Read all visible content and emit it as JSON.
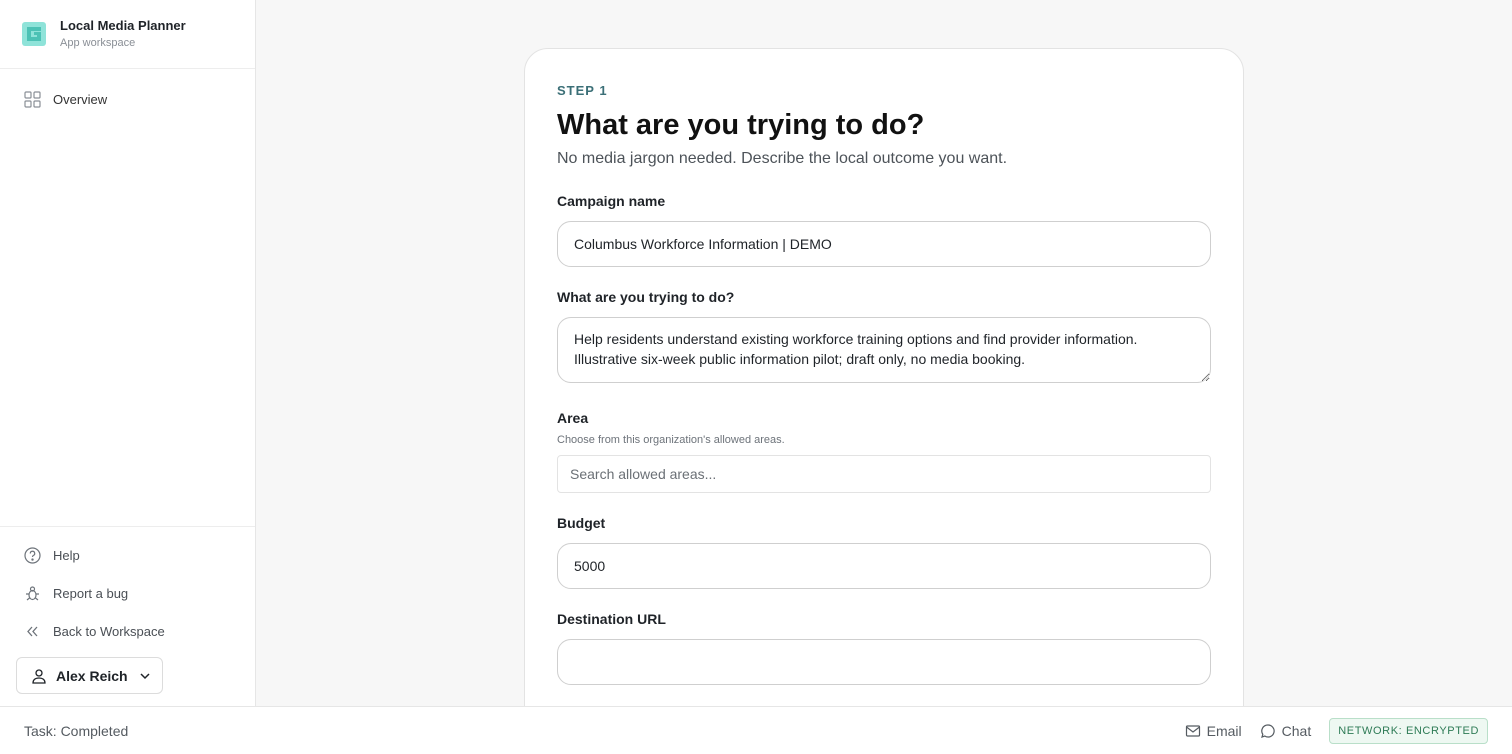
{
  "brand": {
    "title": "Local Media Planner",
    "subtitle": "App workspace"
  },
  "nav": {
    "overview": "Overview"
  },
  "footer_nav": {
    "help": "Help",
    "report_bug": "Report a bug",
    "back": "Back to Workspace"
  },
  "user": {
    "name": "Alex Reich"
  },
  "form": {
    "step": "STEP 1",
    "title": "What are you trying to do?",
    "subtitle": "No media jargon needed. Describe the local outcome you want.",
    "campaign_name": {
      "label": "Campaign name",
      "value": "Columbus Workforce Information | DEMO"
    },
    "goal": {
      "label": "What are you trying to do?",
      "value": "Help residents understand existing workforce training options and find provider information. Illustrative six-week public information pilot; draft only, no media booking."
    },
    "area": {
      "label": "Area",
      "help": "Choose from this organization's allowed areas.",
      "placeholder": "Search allowed areas..."
    },
    "budget": {
      "label": "Budget",
      "value": "5000"
    },
    "destination_url": {
      "label": "Destination URL",
      "value": ""
    }
  },
  "statusbar": {
    "task": "Task: Completed",
    "email": "Email",
    "chat": "Chat",
    "network": "NETWORK: ENCRYPTED"
  },
  "colors": {
    "accent": "#3b6f77",
    "logo": "#5ccfc2",
    "badge_green": "#2e7b56"
  }
}
